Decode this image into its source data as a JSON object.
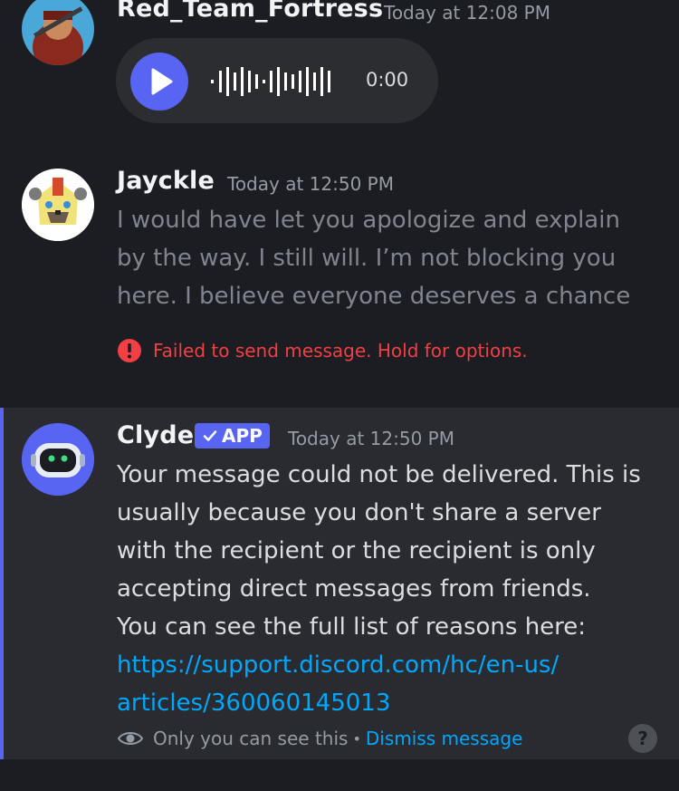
{
  "messages": [
    {
      "username": "Red_Team_Fortress",
      "timestamp": "Today at 12:08 PM",
      "voice": {
        "duration": "0:00"
      }
    },
    {
      "username": "Jayckle",
      "timestamp": "Today at 12:50 PM",
      "lines": [
        "I would have let you apologize and explain",
        "by the way. I still will. I’m not blocking you",
        "here. I believe everyone deserves a chance"
      ],
      "error": "Failed to send message. Hold for options."
    },
    {
      "username": "Clyde",
      "badge": "APP",
      "timestamp": "Today at 12:50 PM",
      "lines": [
        "Your message could not be delivered. This is",
        "usually because you don't share a server",
        "with the recipient or the recipient is only",
        "accepting direct messages from friends.",
        "You can see the full list of reasons here:"
      ],
      "link_lines": [
        "https://support.discord.com/hc/en-us/",
        "articles/360060145013"
      ],
      "ephemeral_note": "Only you can see this",
      "separator": "•",
      "dismiss_label": "Dismiss message",
      "help_glyph": "?"
    }
  ],
  "colors": {
    "background": "#1c1d22",
    "accent": "#5865f2",
    "error": "#f23f43",
    "link": "#00a8fc"
  },
  "icons": [
    "play-icon",
    "waveform-icon",
    "error-icon",
    "checkmark-icon",
    "eye-icon",
    "help-icon"
  ]
}
